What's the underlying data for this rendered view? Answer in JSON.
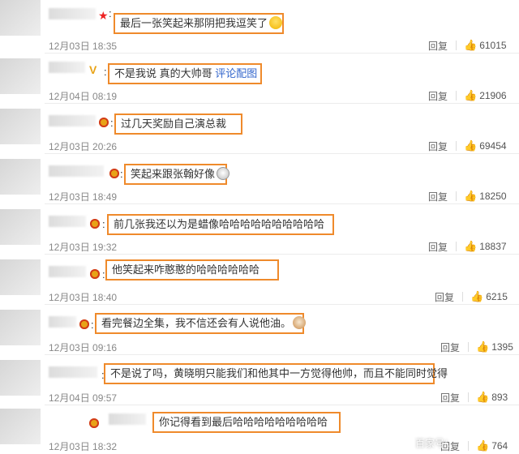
{
  "reply_label": "回复",
  "watermark": "百家号/...",
  "comments": [
    {
      "text": "最后一张笑起来那阴把我逗笑了",
      "emoji": "laugh-emoji",
      "date": "12月03日 18:35",
      "likes": "61015"
    },
    {
      "text": "不是我说 真的大帅哥",
      "link": "评论配图",
      "date": "12月04日 08:19",
      "likes": "21906"
    },
    {
      "text": "过几天奖励自己演总裁",
      "date": "12月03日 20:26",
      "likes": "69454"
    },
    {
      "text": "笑起来跟张翰好像",
      "emoji": "cat-emoji",
      "date": "12月03日 18:49",
      "likes": "18250"
    },
    {
      "text": "前几张我还以为是蜡像哈哈哈哈哈哈哈哈哈哈",
      "date": "12月03日 19:32",
      "likes": "18837"
    },
    {
      "text": "他笑起来咋憨憨的哈哈哈哈哈哈",
      "date": "12月03日 18:40",
      "likes": "6215"
    },
    {
      "text": "看完餐边全集，我不信还会有人说他油。",
      "emoji": "dog-emoji",
      "date": "12月03日 09:16",
      "likes": "1395"
    },
    {
      "text": "不是说了吗，黄晓明只能我们和他其中一方觉得他帅，而且不能同时觉得",
      "date": "12月04日 09:57",
      "likes": "893"
    },
    {
      "text": "你记得看到最后哈哈哈哈哈哈哈哈哈",
      "date": "12月03日 18:32",
      "likes": "764"
    }
  ]
}
